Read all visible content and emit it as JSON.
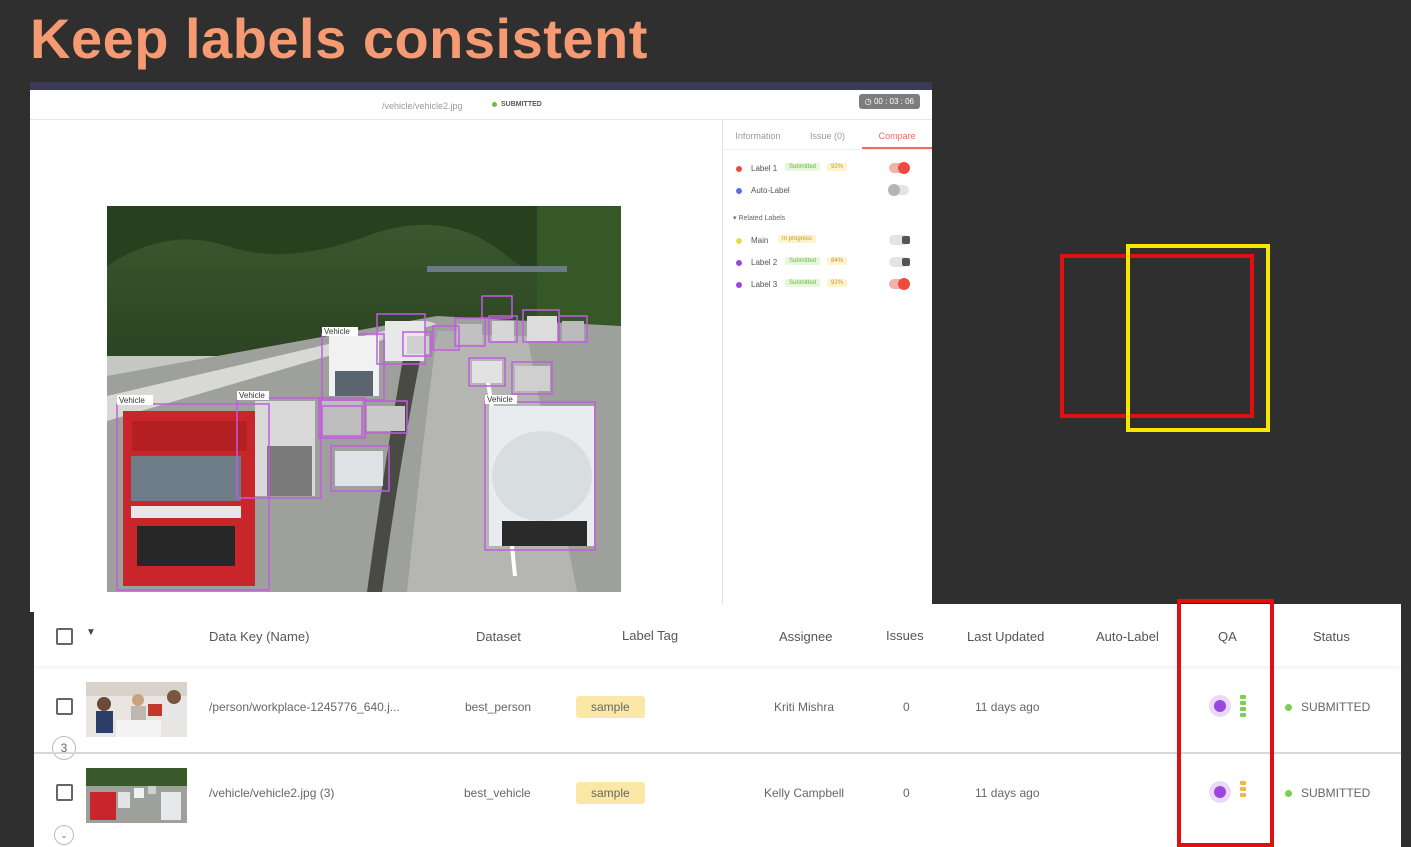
{
  "slide": {
    "title": "Keep labels consistent"
  },
  "editor": {
    "file_path": "/vehicle/vehicle2.jpg",
    "status": "SUBMITTED",
    "timer": "00 : 03 : 06",
    "image_label": "Vehicle",
    "panel": {
      "tabs": [
        "Information",
        "Issue (0)",
        "Compare"
      ],
      "active_tab": "Compare",
      "labels": [
        {
          "name": "Label 1",
          "badge": "Submitted",
          "percent": "92%",
          "color": "#ee4b3f",
          "toggle": "on"
        },
        {
          "name": "Auto-Label",
          "badge": "",
          "percent": "",
          "color": "#5b6ee8",
          "toggle": "off"
        }
      ],
      "related_header": "Related Labels",
      "related": [
        {
          "name": "Main",
          "badge": "In progress",
          "percent": "",
          "color": "#e0e050",
          "toggle": "dark"
        },
        {
          "name": "Label 2",
          "badge": "Submitted",
          "percent": "84%",
          "color": "#9a47e0",
          "toggle": "dark"
        },
        {
          "name": "Label 3",
          "badge": "Submitted",
          "percent": "92%",
          "color": "#9a47e0",
          "toggle": "on"
        }
      ]
    }
  },
  "table": {
    "headers": {
      "data_key": "Data Key (Name)",
      "dataset": "Dataset",
      "label_tag": "Label Tag",
      "assignee": "Assignee",
      "issues": "Issues",
      "last_updated": "Last Updated",
      "auto_label": "Auto-Label",
      "qa": "QA",
      "status": "Status"
    },
    "rows": [
      {
        "data_key": "/person/workplace-1245776_640.j...",
        "dataset": "best_person",
        "label_tag": "sample",
        "assignee": "Kriti Mishra",
        "issues": "0",
        "last_updated": "11 days ago",
        "status": "SUBMITTED",
        "qa_colors": [
          "#7bd04d",
          "#7bd04d",
          "#7bd04d",
          "#7bd04d"
        ]
      },
      {
        "data_key": "/vehicle/vehicle2.jpg (3)",
        "dataset": "best_vehicle",
        "label_tag": "sample",
        "assignee": "Kelly Campbell",
        "issues": "0",
        "last_updated": "11 days ago",
        "status": "SUBMITTED",
        "qa_colors": [
          "#f0b840",
          "#f0b840",
          "#f0b840"
        ]
      }
    ],
    "row_count_badge": "3"
  },
  "colors": {
    "title": "#f59a72",
    "highlight_red": "#e01010",
    "highlight_yellow": "#f5e800",
    "submitted": "#7bd04d",
    "accent": "#f06a5c"
  }
}
